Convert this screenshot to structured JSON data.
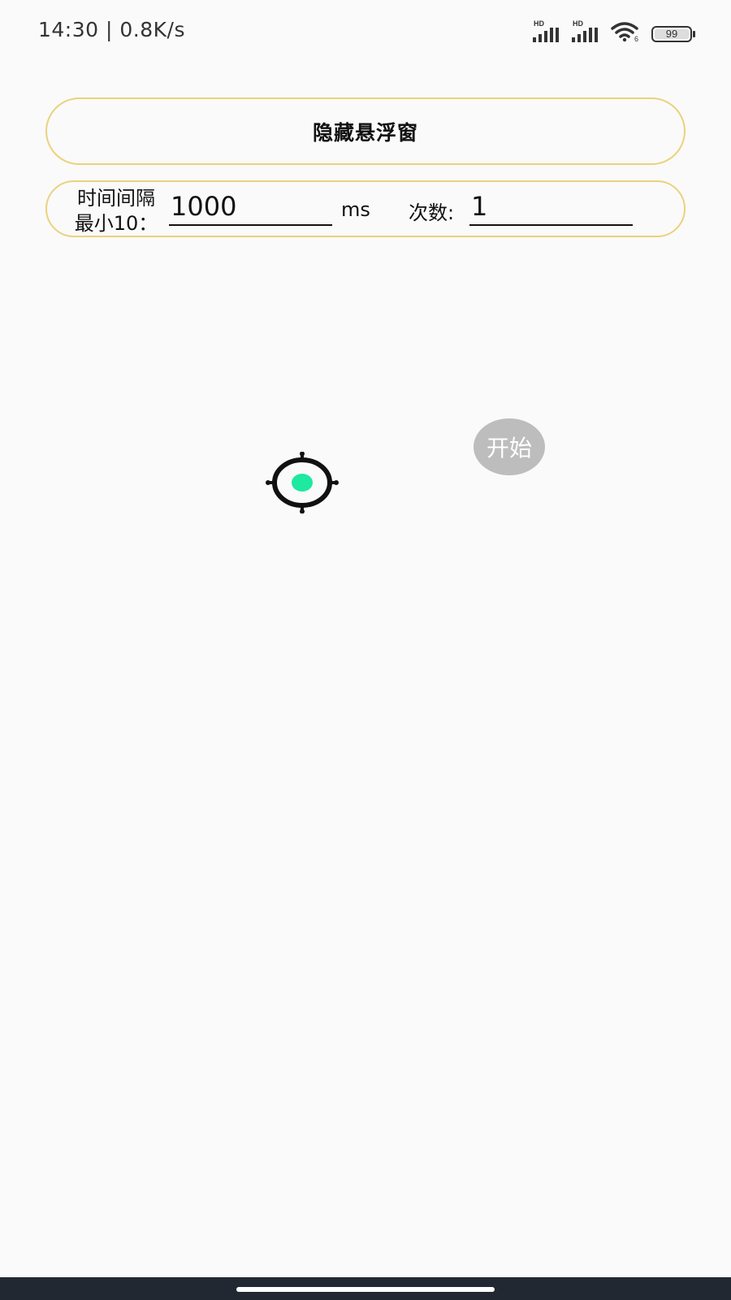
{
  "status_bar": {
    "time_speed": "14:30 | 0.8K/s",
    "signal_1_label": "HD",
    "signal_2_label": "HD",
    "wifi_label": "6",
    "battery_level": "99",
    "battery_fraction": 0.99,
    "icons": [
      "signal-hd-icon",
      "signal-hd-icon",
      "wifi-icon",
      "battery-icon"
    ]
  },
  "hide_button": {
    "label": "隐藏悬浮窗"
  },
  "settings": {
    "interval_label_line1": "时间间隔",
    "interval_label_line2": "最小10：",
    "interval_value": "1000",
    "interval_unit": "ms",
    "count_label": "次数:",
    "count_value": "1"
  },
  "start_button": {
    "label": "开始"
  },
  "target": {
    "icon": "crosshair-target-icon",
    "ring_color": "#111111",
    "dot_color": "#1de9a0"
  },
  "colors": {
    "pill_border": "#ead27e",
    "start_bg": "#bdbdbd",
    "nav_bar": "#222832"
  }
}
